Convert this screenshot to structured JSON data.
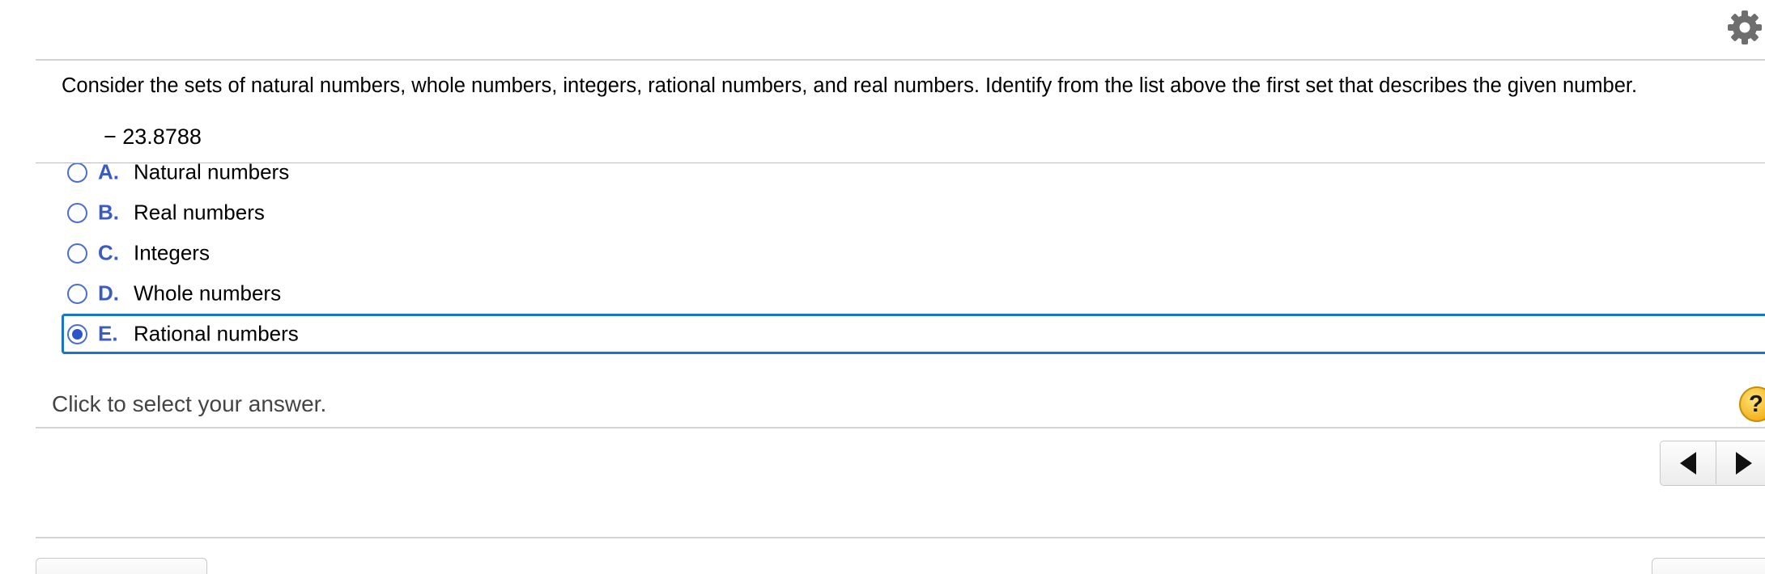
{
  "toolbar": {
    "settings_icon": "gear-icon"
  },
  "question": {
    "prompt": "Consider the sets of natural numbers, whole numbers, integers, rational numbers, and real numbers. Identify from the list above the first set that describes the given number.",
    "given_number": "− 23.8788"
  },
  "choices": [
    {
      "letter": "A.",
      "text": "Natural numbers",
      "selected": false
    },
    {
      "letter": "B.",
      "text": "Real numbers",
      "selected": false
    },
    {
      "letter": "C.",
      "text": "Integers",
      "selected": false
    },
    {
      "letter": "D.",
      "text": "Whole numbers",
      "selected": false
    },
    {
      "letter": "E.",
      "text": "Rational numbers",
      "selected": true
    }
  ],
  "status": {
    "text": "Click to select your answer.",
    "help_label": "?"
  },
  "navigation": {
    "prev_icon": "triangle-left-icon",
    "next_icon": "triangle-right-icon"
  },
  "colors": {
    "accent_blue": "#1776c9",
    "choice_letter": "#3b5bc4",
    "help_yellow": "#f3b420"
  }
}
